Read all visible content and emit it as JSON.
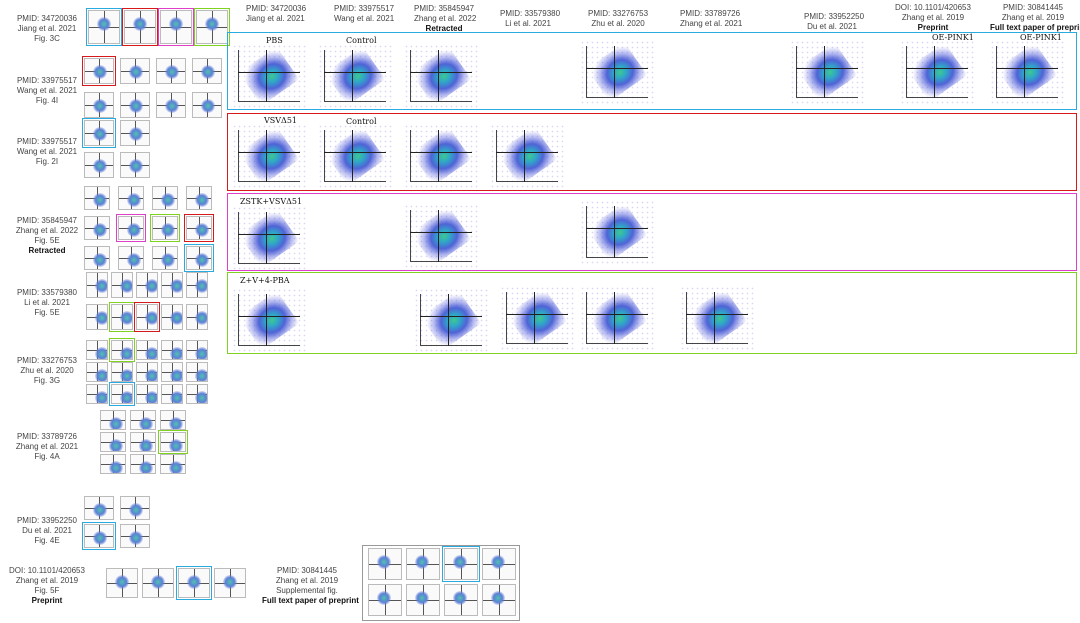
{
  "left_labels": [
    {
      "pmid": "PMID: 34720036",
      "authors": "Jiang et al. 2021",
      "fig": "Fig. 3C",
      "note": ""
    },
    {
      "pmid": "PMID: 33975517",
      "authors": "Wang et al. 2021",
      "fig": "Fig. 4I",
      "note": ""
    },
    {
      "pmid": "PMID: 33975517",
      "authors": "Wang et al. 2021",
      "fig": "Fig. 2I",
      "note": ""
    },
    {
      "pmid": "PMID: 35845947",
      "authors": "Zhang et al. 2022",
      "fig": "Fig. 5E",
      "note": "Retracted"
    },
    {
      "pmid": "PMID: 33579380",
      "authors": "Li et al. 2021",
      "fig": "Fig. 5E",
      "note": ""
    },
    {
      "pmid": "PMID: 33276753",
      "authors": "Zhu et al. 2020",
      "fig": "Fig. 3G",
      "note": ""
    },
    {
      "pmid": "PMID: 33789726",
      "authors": "Zhang et al. 2021",
      "fig": "Fig. 4A",
      "note": ""
    },
    {
      "pmid": "PMID: 33952250",
      "authors": "Du et al. 2021",
      "fig": "Fig. 4E",
      "note": ""
    },
    {
      "pmid": "DOI: 10.1101/420653",
      "authors": "Zhang et al. 2019",
      "fig": "Fig. 5F",
      "note": "Preprint"
    }
  ],
  "bottom_label": {
    "pmid": "PMID: 30841445",
    "authors": "Zhang et al. 2019",
    "fig": "Supplemental fig.",
    "note": "Full text paper of preprint"
  },
  "top_headers": [
    {
      "pmid": "PMID: 34720036",
      "authors": "Jiang et al. 2021",
      "note": ""
    },
    {
      "pmid": "PMID: 33975517",
      "authors": "Wang et al. 2021",
      "note": ""
    },
    {
      "pmid": "PMID: 35845947",
      "authors": "Zhang et al. 2022",
      "note": "Retracted"
    },
    {
      "pmid": "PMID: 33579380",
      "authors": "Li et al. 2021",
      "note": ""
    },
    {
      "pmid": "PMID: 33276753",
      "authors": "Zhu et al. 2020",
      "note": ""
    },
    {
      "pmid": "PMID: 33789726",
      "authors": "Zhang et al. 2021",
      "note": ""
    },
    {
      "pmid": "PMID: 33952250",
      "authors": "Du et al. 2021",
      "note": ""
    },
    {
      "pmid": "DOI: 10.1101/420653",
      "authors": "Zhang et al. 2019",
      "note": "Preprint"
    },
    {
      "pmid": "PMID: 30841445",
      "authors": "Zhang et al. 2019",
      "note": "Full text paper of preprint"
    }
  ],
  "band_titles": {
    "blue": [
      "PBS",
      "Control",
      "OE-PINK1",
      "OE-PINK1"
    ],
    "red": [
      "VSVΔ51",
      "Control"
    ],
    "magenta": [
      "ZSTK+VSVΔ51"
    ],
    "green": [
      "Z+V+4-PBA"
    ]
  },
  "colors": {
    "blue": "#29abe2",
    "red": "#d7191c",
    "magenta": "#e040c8",
    "green": "#7ed321"
  }
}
